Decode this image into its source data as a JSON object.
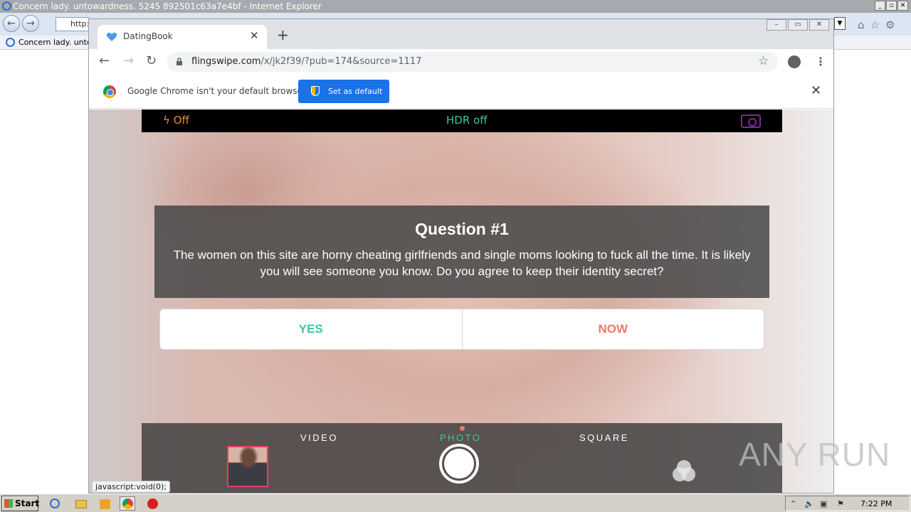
{
  "ie": {
    "title": "Concern lady. untowardness. 5245 892501c63a7e4bf - Internet Explorer",
    "address_partial": "http:",
    "tab_label": "Concern lady. untow"
  },
  "chrome": {
    "tab_title": "DatingBook",
    "url_host": "flingswipe.com",
    "url_path": "/x/jk2f39/?pub=174&source=1117",
    "infobar_text": "Google Chrome isn't your default browser",
    "set_default_label": "Set as default",
    "status_url": "javascript:void(0);"
  },
  "camera": {
    "flash_label": "Off",
    "hdr_label": "HDR off",
    "modes": [
      "VIDEO",
      "PHOTO",
      "SQUARE"
    ],
    "active_mode": "PHOTO"
  },
  "question": {
    "title": "Question #1",
    "text": "The women on this site are horny cheating girlfriends and single moms looking to fuck all the time. It is likely you will see someone you know. Do you agree to keep their identity secret?",
    "yes_label": "YES",
    "no_label": "NOW"
  },
  "watermark": "ANY RUN",
  "taskbar": {
    "start_label": "Start",
    "clock": "7:22 PM"
  },
  "colors": {
    "accent_green": "#3ec6a0",
    "accent_coral": "#f0786a",
    "flash_orange": "#f08a2e",
    "chrome_blue": "#1a73e8"
  },
  "icons": [
    "ie-logo",
    "back-icon",
    "forward-icon",
    "home-icon",
    "star-icon",
    "gear-icon",
    "heart-icon",
    "close-icon",
    "plus-icon",
    "reload-icon",
    "lock-icon",
    "profile-icon",
    "menu-icon",
    "chrome-logo",
    "shield-icon",
    "flash-icon",
    "camera-switch-icon",
    "shutter-icon",
    "filters-icon"
  ]
}
